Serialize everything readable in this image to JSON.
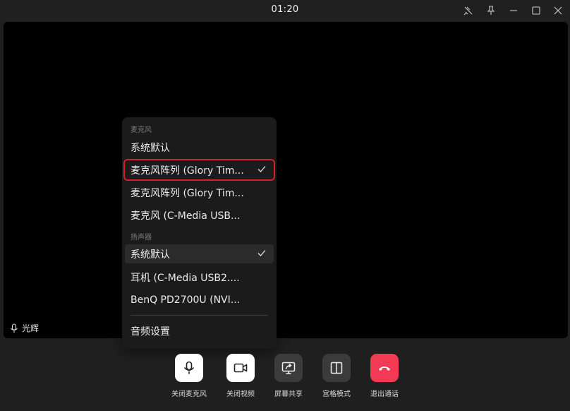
{
  "window": {
    "time": "01:20",
    "controls": [
      "pin-off-icon",
      "pin-icon",
      "minimize-icon",
      "maximize-icon",
      "close-icon"
    ]
  },
  "participant": {
    "name": "光辉",
    "icon": "microphone-icon"
  },
  "device_menu": {
    "microphone_section": "麦克风",
    "microphones": [
      {
        "label": "系统默认",
        "checked": false
      },
      {
        "label": "麦克风阵列 (Glory Tim...",
        "checked": true
      },
      {
        "label": "麦克风阵列 (Glory Tim...",
        "checked": false
      },
      {
        "label": "麦克风 (C-Media USB...",
        "checked": false
      }
    ],
    "speaker_section": "扬声器",
    "speakers": [
      {
        "label": "系统默认",
        "checked": true
      },
      {
        "label": "耳机 (C-Media USB2....",
        "checked": false
      },
      {
        "label": "BenQ PD2700U (NVI...",
        "checked": false
      }
    ],
    "audio_settings": "音频设置"
  },
  "toolbar": {
    "mute": {
      "label": "关闭麦克风",
      "icon": "microphone-icon"
    },
    "video": {
      "label": "关闭视频",
      "icon": "camera-icon"
    },
    "share": {
      "label": "屏幕共享",
      "icon": "screen-share-icon"
    },
    "grid": {
      "label": "宫格模式",
      "icon": "grid-layout-icon"
    },
    "leave": {
      "label": "退出通话",
      "icon": "hang-up-icon"
    }
  },
  "colors": {
    "highlight_outline": "#d3202a",
    "leave_button": "#f23a54",
    "background": "#1f1f1f"
  }
}
